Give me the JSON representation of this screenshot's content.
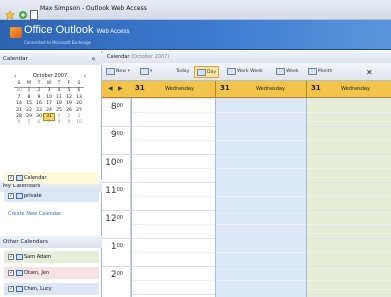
{
  "window": {
    "title": "Max Simpson - Outlook Web Access"
  },
  "header": {
    "brand_main": "Office Outlook",
    "brand_sub": "Web Access",
    "tagline": "Connected to Microsoft Exchange"
  },
  "sidebar": {
    "section_title": "Calendar",
    "mini_calendar": {
      "month_label": "October 2007",
      "prev": "‹",
      "next": "›",
      "weekdays": [
        "S",
        "M",
        "T",
        "W",
        "T",
        "F",
        "S"
      ],
      "weeks": [
        [
          "30",
          "1",
          "2",
          "3",
          "4",
          "5",
          "6"
        ],
        [
          "7",
          "8",
          "9",
          "10",
          "11",
          "12",
          "13"
        ],
        [
          "14",
          "15",
          "16",
          "17",
          "18",
          "19",
          "20"
        ],
        [
          "21",
          "22",
          "23",
          "24",
          "25",
          "26",
          "27"
        ],
        [
          "28",
          "29",
          "30",
          "31",
          "1",
          "2",
          "3"
        ],
        [
          "4",
          "5",
          "6",
          "7",
          "8",
          "9",
          "10"
        ]
      ],
      "selected_day": "31"
    },
    "my_calendars_title": "My Calendars",
    "my_calendars": [
      {
        "label": "Calendar"
      },
      {
        "label": "private"
      }
    ],
    "create_link": "Create New Calendar",
    "other_calendars_title": "Other Calendars",
    "other_calendars": [
      {
        "label": "Sam Adam"
      },
      {
        "label": "Olsen, Jen"
      },
      {
        "label": "Chen, Lucy"
      }
    ]
  },
  "main": {
    "breadcrumb": "Calendar",
    "breadcrumb_date": "(October 2007)",
    "toolbar": {
      "new": "New",
      "today": "Today",
      "day": "Day",
      "work_week": "Work Week",
      "week": "Week",
      "month": "Month",
      "close": "✕"
    },
    "days": [
      {
        "num": "31",
        "weekday": "Wednesday"
      },
      {
        "num": "31",
        "weekday": "Wednesday"
      },
      {
        "num": "31",
        "weekday": "Wednesday"
      }
    ],
    "hours": [
      {
        "h": "8",
        "m": "00"
      },
      {
        "h": "9",
        "m": "00"
      },
      {
        "h": "10",
        "m": "00"
      },
      {
        "h": "11",
        "m": "00"
      },
      {
        "h": "12",
        "m": "00"
      },
      {
        "h": "1",
        "m": "00"
      },
      {
        "h": "2",
        "m": "00"
      }
    ]
  },
  "colors": {
    "calendar_col": "#ffffff",
    "private_col": "#dbe7f6",
    "other_col": "#e6eed8",
    "day_header": "#f2c44a"
  }
}
